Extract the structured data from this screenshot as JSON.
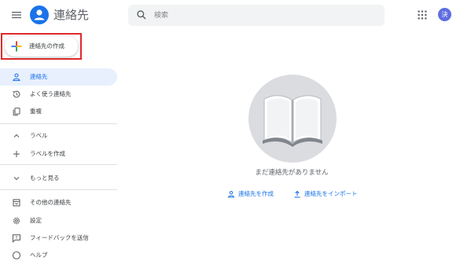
{
  "header": {
    "app_title": "連絡先",
    "search": {
      "placeholder": "検索",
      "value": ""
    },
    "avatar_initial": "決"
  },
  "create_button": {
    "label": "連絡先の作成"
  },
  "sidebar": {
    "items": [
      {
        "label": "連絡先",
        "icon": "person-icon",
        "active": true
      },
      {
        "label": "よく使う連絡先",
        "icon": "history-icon"
      },
      {
        "label": "重複",
        "icon": "duplicate-icon"
      },
      {
        "label": "ラベル",
        "icon": "chevron-up-icon"
      },
      {
        "label": "ラベルを作成",
        "icon": "plus-icon"
      },
      {
        "label": "もっと見る",
        "icon": "chevron-down-icon"
      },
      {
        "label": "その他の連絡先",
        "icon": "archive-icon"
      },
      {
        "label": "設定",
        "icon": "gear-icon"
      },
      {
        "label": "フィードバックを送信",
        "icon": "feedback-icon"
      },
      {
        "label": "ヘルプ",
        "icon": "help-icon"
      }
    ]
  },
  "main": {
    "empty_message": "まだ連絡先がありません",
    "create_contact_link": "連絡先を作成",
    "import_link": "連絡先をインポート"
  },
  "colors": {
    "accent": "#1a73e8",
    "highlight_border": "#e0292c",
    "avatar_bg": "#5e6ee0",
    "active_bg": "#e8f0fe"
  }
}
